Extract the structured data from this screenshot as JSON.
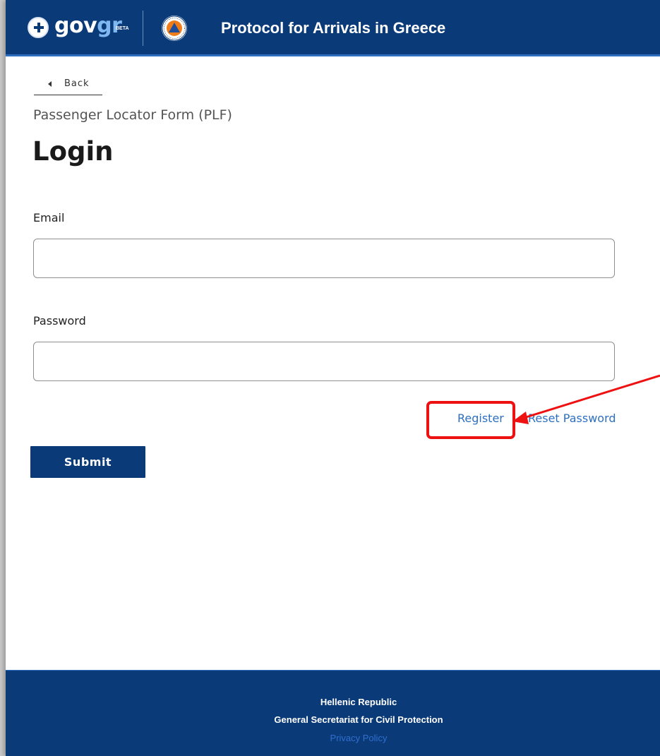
{
  "header": {
    "brand_prefix": "gov",
    "brand_suffix": "gr",
    "brand_badge": "BETA",
    "app_title": "Protocol for Arrivals in Greece",
    "colors": {
      "bar": "#0b3a78",
      "accent": "#7fb7f0"
    },
    "icons": [
      "greek-state-seal-icon",
      "civil-protection-logo-icon"
    ]
  },
  "nav": {
    "back_label": "Back"
  },
  "form": {
    "subtitle": "Passenger Locator Form (PLF)",
    "title": "Login",
    "email_label": "Email",
    "email_value": "",
    "password_label": "Password",
    "password_value": "",
    "register_link": "Register",
    "reset_link": "Reset Password",
    "submit_label": "Submit"
  },
  "annotation": {
    "highlight_color": "#ee1111",
    "target": "Register"
  },
  "footer": {
    "line1": "Hellenic Republic",
    "line2": "General Secretariat for Civil Protection",
    "privacy_link": "Privacy Policy"
  }
}
